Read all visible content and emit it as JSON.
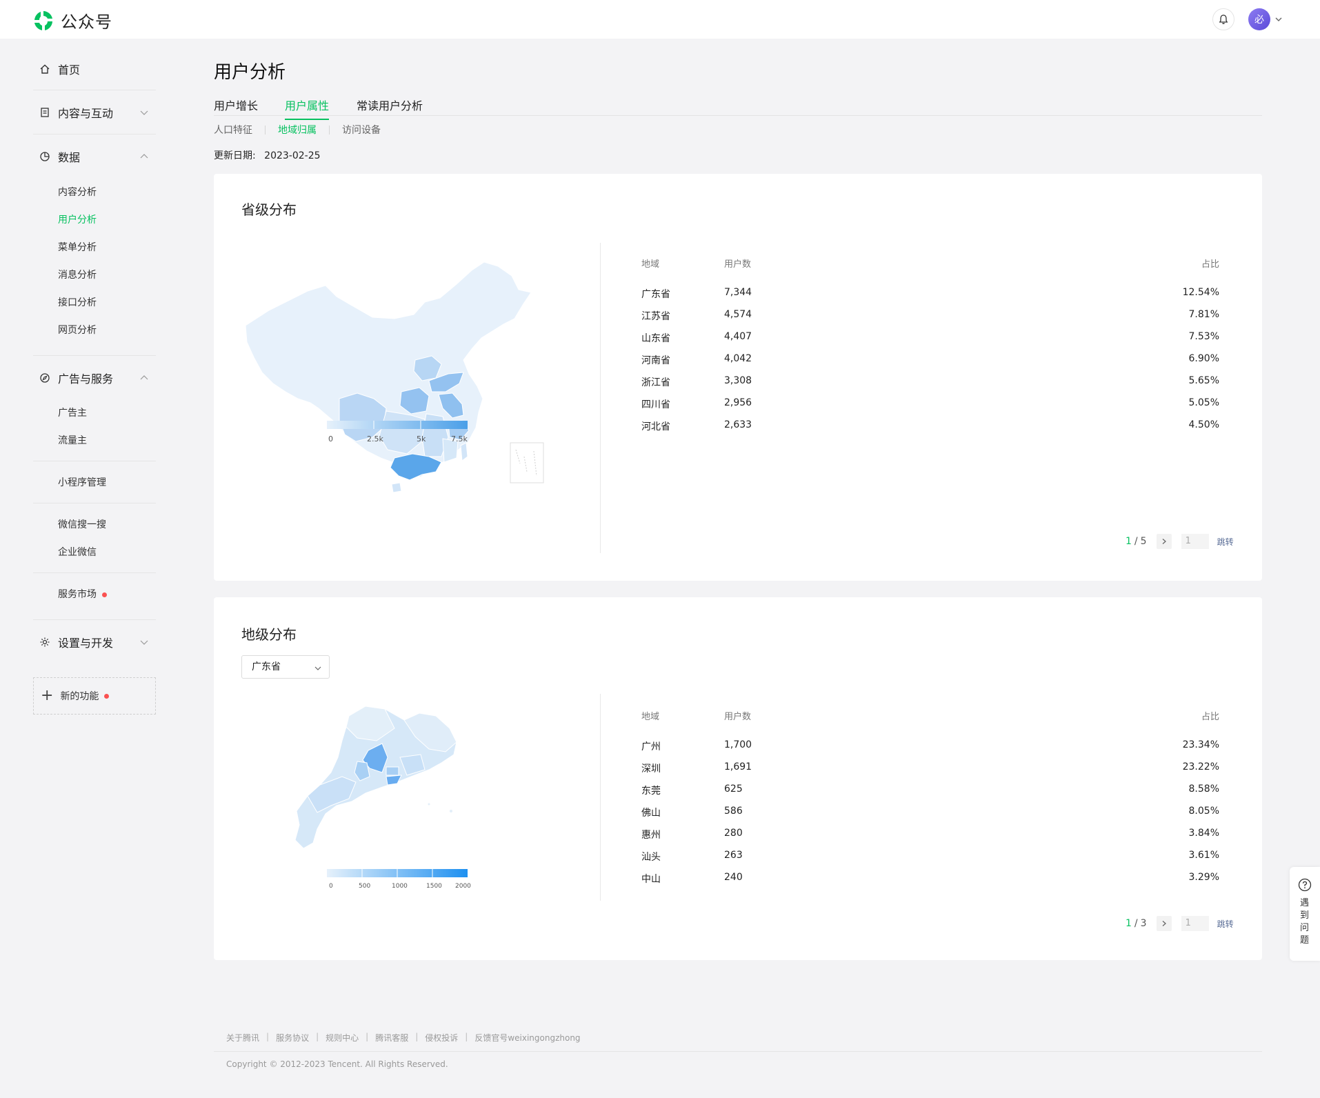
{
  "app": {
    "logo_text": "公众号",
    "avatar_text": "必"
  },
  "sidebar": {
    "home": "首页",
    "content": "内容与互动",
    "data": "数据",
    "data_items": [
      "内容分析",
      "用户分析",
      "菜单分析",
      "消息分析",
      "接口分析",
      "网页分析"
    ],
    "ads": "广告与服务",
    "ads_items": [
      "广告主",
      "流量主"
    ],
    "miniprogram": "小程序管理",
    "search": "微信搜一搜",
    "work_wechat": "企业微信",
    "market": "服务市场",
    "settings": "设置与开发",
    "new_features": "新的功能"
  },
  "page": {
    "title": "用户分析",
    "tabs": [
      "用户增长",
      "用户属性",
      "常读用户分析"
    ],
    "subtabs": [
      "人口特征",
      "地域归属",
      "访问设备"
    ],
    "update_label": "更新日期:",
    "update_date": "2023-02-25"
  },
  "province": {
    "title": "省级分布",
    "headers": {
      "region": "地域",
      "users": "用户数",
      "share": "占比"
    },
    "rows": [
      {
        "region": "广东省",
        "users": "7,344",
        "share": "12.54%"
      },
      {
        "region": "江苏省",
        "users": "4,574",
        "share": "7.81%"
      },
      {
        "region": "山东省",
        "users": "4,407",
        "share": "7.53%"
      },
      {
        "region": "河南省",
        "users": "4,042",
        "share": "6.90%"
      },
      {
        "region": "浙江省",
        "users": "3,308",
        "share": "5.65%"
      },
      {
        "region": "四川省",
        "users": "2,956",
        "share": "5.05%"
      },
      {
        "region": "河北省",
        "users": "2,633",
        "share": "4.50%"
      }
    ],
    "legend": [
      "0",
      "2.5k",
      "5k",
      "7.5k"
    ],
    "pager": {
      "current": "1",
      "total": "5",
      "input": "1",
      "jump": "跳转"
    }
  },
  "city": {
    "title": "地级分布",
    "select_value": "广东省",
    "headers": {
      "region": "地域",
      "users": "用户数",
      "share": "占比"
    },
    "rows": [
      {
        "region": "广州",
        "users": "1,700",
        "share": "23.34%"
      },
      {
        "region": "深圳",
        "users": "1,691",
        "share": "23.22%"
      },
      {
        "region": "东莞",
        "users": "625",
        "share": "8.58%"
      },
      {
        "region": "佛山",
        "users": "586",
        "share": "8.05%"
      },
      {
        "region": "惠州",
        "users": "280",
        "share": "3.84%"
      },
      {
        "region": "汕头",
        "users": "263",
        "share": "3.61%"
      },
      {
        "region": "中山",
        "users": "240",
        "share": "3.29%"
      }
    ],
    "legend": [
      "0",
      "500",
      "1000",
      "1500",
      "2000"
    ],
    "pager": {
      "current": "1",
      "total": "3",
      "input": "1",
      "jump": "跳转"
    }
  },
  "footer": {
    "links": [
      "关于腾讯",
      "服务协议",
      "规则中心",
      "腾讯客服",
      "侵权投诉",
      "反馈官号weixingongzhong"
    ],
    "copyright": "Copyright © 2012-2023 Tencent. All Rights Reserved."
  },
  "help": {
    "label": "遇到问题"
  },
  "colors": {
    "accent": "#07c160",
    "map_light": "#e6f1fb",
    "map_dark": "#4a9fe8",
    "red": "#fa5151"
  }
}
